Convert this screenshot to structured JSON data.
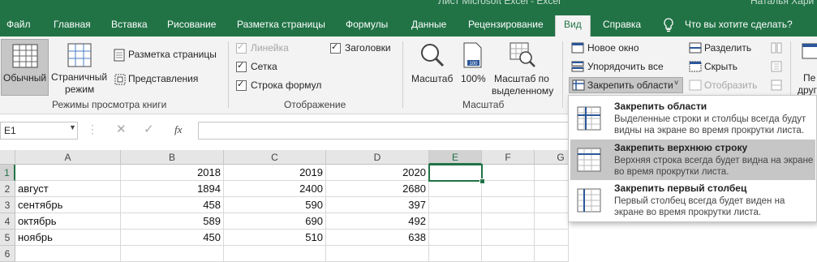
{
  "title_text": "Лист Microsoft Excel  -  Excel",
  "user_name": "Наталья Хари",
  "tabs": [
    "Файл",
    "Главная",
    "Вставка",
    "Рисование",
    "Разметка страницы",
    "Формулы",
    "Данные",
    "Рецензирование",
    "Вид",
    "Справка"
  ],
  "active_tab": "Вид",
  "tell_me": "Что вы хотите сделать?",
  "ribbon": {
    "views": {
      "normal": "Обычный",
      "page_break_1": "Страничный",
      "page_break_2": "режим",
      "page_layout": "Разметка страницы",
      "custom_views": "Представления",
      "group_label": "Режимы просмотра книги"
    },
    "show": {
      "ruler": "Линейка",
      "gridlines": "Сетка",
      "formula_bar": "Строка формул",
      "headings": "Заголовки",
      "group_label": "Отображение"
    },
    "zoom": {
      "zoom": "Масштаб",
      "hundred": "100%",
      "to_selection_1": "Масштаб по",
      "to_selection_2": "выделенному",
      "group_label": "Масштаб"
    },
    "window": {
      "new_window": "Новое окно",
      "arrange_all": "Упорядочить все",
      "freeze_panes": "Закрепить области",
      "split": "Разделить",
      "hide": "Скрыть",
      "unhide": "Отобразить",
      "macros_partial_1": "Пе",
      "macros_partial_2": "други"
    }
  },
  "formula_bar": {
    "name_box": "E1",
    "fx": "fx",
    "value": ""
  },
  "columns": [
    "A",
    "B",
    "C",
    "D",
    "E",
    "F",
    "G"
  ],
  "rows": [
    {
      "num": "1",
      "a": "",
      "b": "2018",
      "c": "2019",
      "d": "2020"
    },
    {
      "num": "2",
      "a": "август",
      "b": "1894",
      "c": "2400",
      "d": "2680"
    },
    {
      "num": "3",
      "a": "сентябрь",
      "b": "458",
      "c": "590",
      "d": "397"
    },
    {
      "num": "4",
      "a": "октябрь",
      "b": "589",
      "c": "690",
      "d": "492"
    },
    {
      "num": "5",
      "a": "ноябрь",
      "b": "450",
      "c": "510",
      "d": "638"
    },
    {
      "num": "6",
      "a": "",
      "b": "",
      "c": "",
      "d": ""
    }
  ],
  "freeze_menu": [
    {
      "title": "Закрепить области",
      "desc": "Выделенные строки и столбцы всегда будут видны на экране во время прокрутки листа."
    },
    {
      "title": "Закрепить верхнюю строку",
      "desc": "Верхняя строка всегда будет видна на экране во время прокрутки листа."
    },
    {
      "title": "Закрепить первый столбец",
      "desc": "Первый столбец всегда будет виден на экране во время прокрутки листа."
    }
  ],
  "colors": {
    "accent": "#217346",
    "highlight": "#c6c6c6"
  }
}
